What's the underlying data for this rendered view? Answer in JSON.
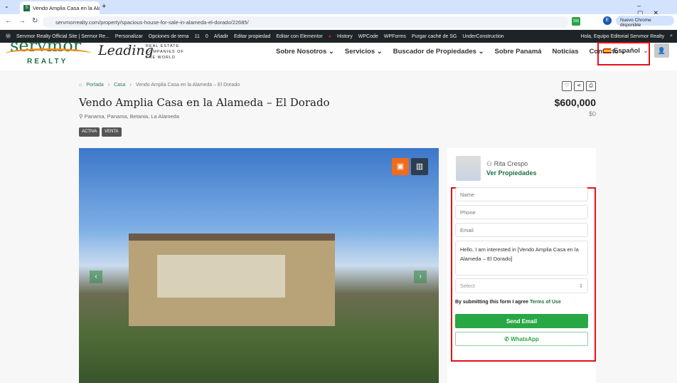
{
  "browser": {
    "tab_title": "Vendo Amplia Casa en la Alameda",
    "url": "servmorrealty.com/property/spacious-house-for-sale-in-alameda-el-dorado/22685/",
    "chrome_update": "Nuevo Chrome disponible",
    "profile": "E",
    "ext_badge": "200"
  },
  "adminbar": {
    "items": [
      "Servmor Realty Official Site | Sermor Re...",
      "Personalizar",
      "Opciones de tema",
      "11",
      "0",
      "Añadir",
      "Editar propiedad",
      "Editar con Elementor",
      "History",
      "WPCode",
      "WPForms",
      "Purgar caché de SG",
      "UnderConstruction"
    ],
    "greeting": "Hola, Equipo Editorial Servmor Realty"
  },
  "header": {
    "logo_top": "servmor",
    "logo_bottom": "REALTY",
    "partner_script": "Leading",
    "partner_text": "REAL ESTATE COMPANIES OF THE WORLD",
    "nav": [
      "Sobre Nosotros",
      "Servicios",
      "Buscador de Propiedades",
      "Sobre Panamá",
      "Noticias",
      "Contacto"
    ],
    "language": "Español"
  },
  "breadcrumb": [
    "Portada",
    "Casa",
    "Vendo Amplia Casa en la Alameda – El Dorado"
  ],
  "property": {
    "title": "Vendo Amplia Casa en la Alameda – El Dorado",
    "location": "Panama, Panama, Betania, La Alameda",
    "badges": [
      "ACTIVA",
      "VENTA"
    ],
    "price": "$600,000",
    "price_secondary": "$0"
  },
  "agent": {
    "name": "Rita Crespo",
    "link": "Ver Propiedades"
  },
  "form": {
    "name_placeholder": "Name",
    "phone_placeholder": "Phone",
    "email_placeholder": "Email",
    "message": "Hello, I am interested in [Vendo Amplia Casa en la Alameda – El Dorado]",
    "select": "Select",
    "terms_text": "By submitting this form I agree ",
    "terms_link": "Terms of Use",
    "send": "Send Email",
    "whatsapp": "WhatsApp"
  }
}
